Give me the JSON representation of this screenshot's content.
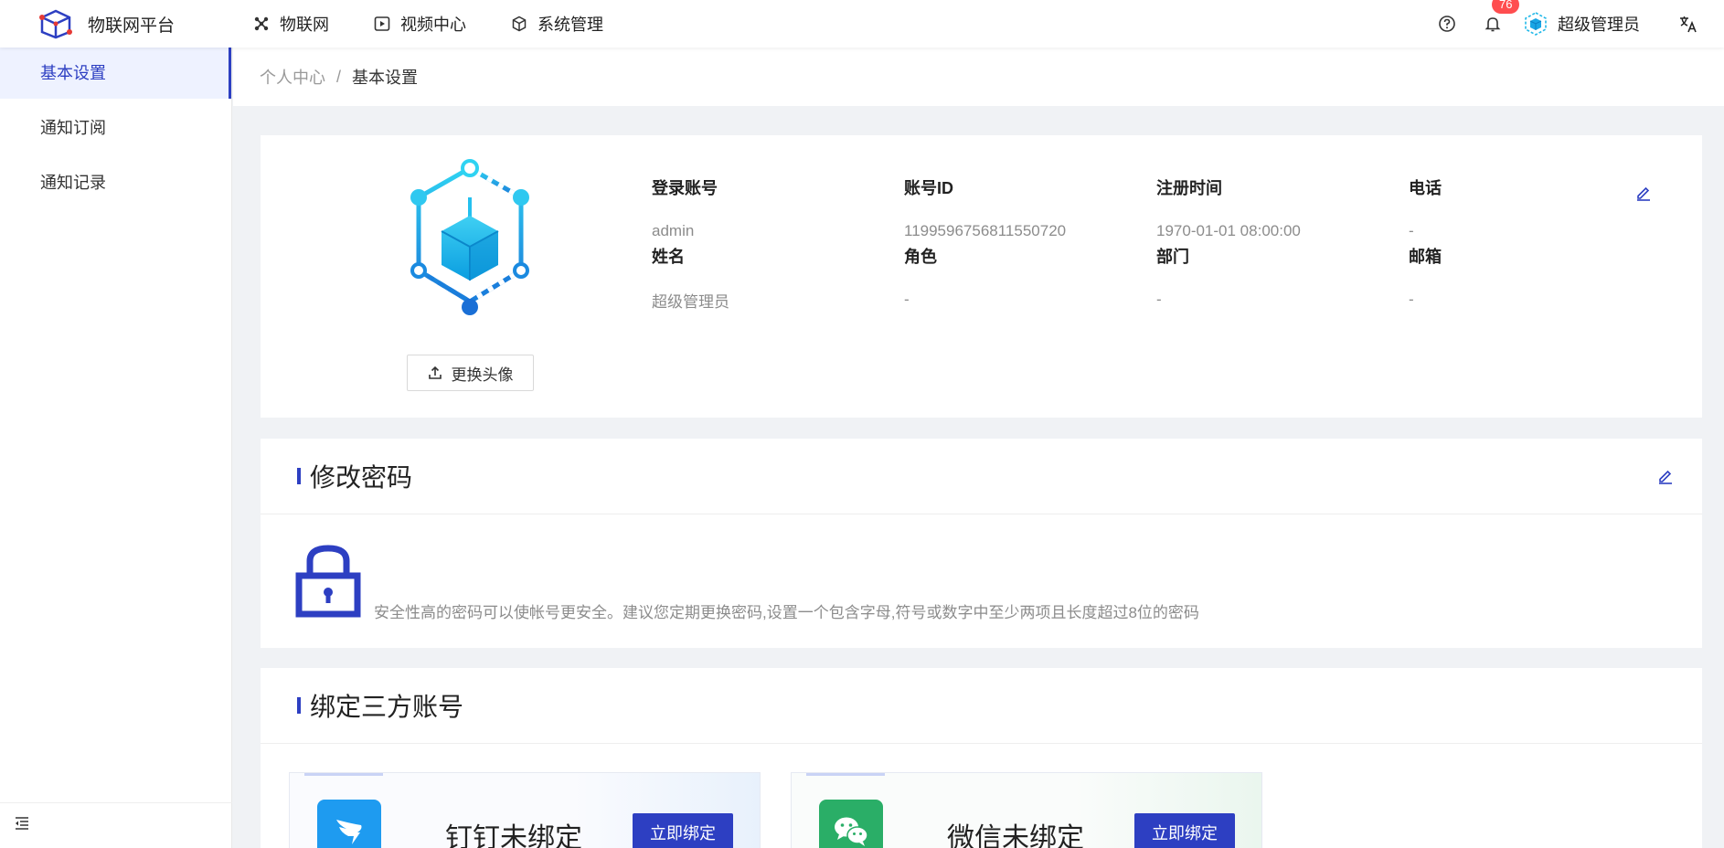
{
  "app": {
    "title": "物联网平台"
  },
  "nav": [
    {
      "label": "物联网",
      "icon": "iot-icon"
    },
    {
      "label": "视频中心",
      "icon": "video-play-icon"
    },
    {
      "label": "系统管理",
      "icon": "cube-settings-icon"
    }
  ],
  "header": {
    "notification_count": "76",
    "user_name": "超级管理员"
  },
  "sidebar": {
    "items": [
      {
        "label": "基本设置",
        "active": true
      },
      {
        "label": "通知订阅",
        "active": false
      },
      {
        "label": "通知记录",
        "active": false
      }
    ]
  },
  "breadcrumb": {
    "parent": "个人中心",
    "separator": "/",
    "current": "基本设置"
  },
  "profile": {
    "change_avatar_label": "更换头像",
    "fields": [
      {
        "label": "登录账号",
        "value": "admin"
      },
      {
        "label": "账号ID",
        "value": "1199596756811550720"
      },
      {
        "label": "注册时间",
        "value": "1970-01-01 08:00:00"
      },
      {
        "label": "电话",
        "value": "-"
      },
      {
        "label": "姓名",
        "value": "超级管理员"
      },
      {
        "label": "角色",
        "value": "-"
      },
      {
        "label": "部门",
        "value": "-"
      },
      {
        "label": "邮箱",
        "value": "-"
      }
    ]
  },
  "password": {
    "title": "修改密码",
    "description": "安全性高的密码可以使帐号更安全。建议您定期更换密码,设置一个包含字母,符号或数字中至少两项且长度超过8位的密码"
  },
  "third_party": {
    "title": "绑定三方账号",
    "cards": [
      {
        "name": "钉钉未绑定",
        "button": "立即绑定",
        "icon": "dingtalk-icon",
        "color": "#1e9bf0"
      },
      {
        "name": "微信未绑定",
        "button": "立即绑定",
        "icon": "wechat-icon",
        "color": "#2aae67"
      }
    ]
  },
  "colors": {
    "primary": "#2d3fc2",
    "badge": "#ff4d4f"
  }
}
